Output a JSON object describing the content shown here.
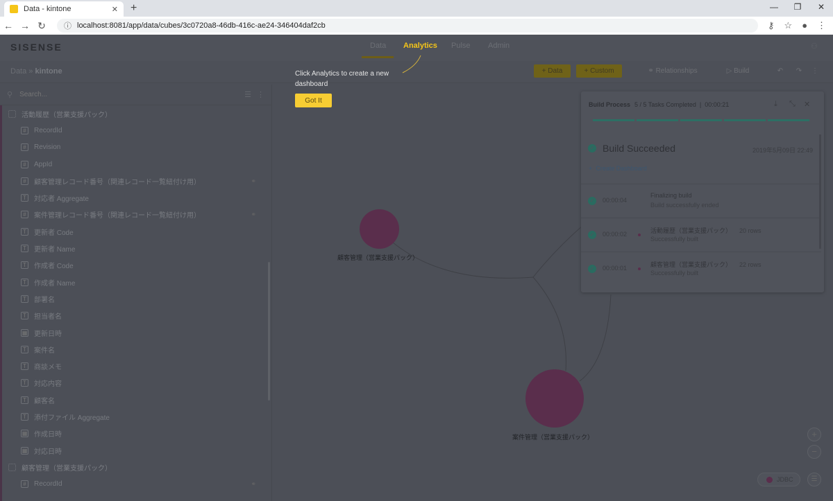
{
  "browser": {
    "tab_title": "Data - kintone",
    "url": "localhost:8081/app/data/cubes/3c0720a8-46db-416c-ae24-346404daf2cb"
  },
  "app": {
    "logo": "SISENSE",
    "nav": [
      "Data",
      "Analytics",
      "Pulse",
      "Admin"
    ]
  },
  "breadcrumb": {
    "root": "Data",
    "current": "kintone"
  },
  "toolbar": {
    "data": "+ Data",
    "custom": "+ Custom",
    "relationships": "Relationships",
    "build": "Build"
  },
  "sidebar": {
    "search_placeholder": "Search...",
    "tables": [
      {
        "name": "活動履歴（営業支援パック）",
        "fields": [
          {
            "name": "RecordId",
            "type": "#"
          },
          {
            "name": "Revision",
            "type": "#"
          },
          {
            "name": "AppId",
            "type": "#"
          },
          {
            "name": "顧客管理レコード番号（関連レコード一覧紐付け用）",
            "type": "#",
            "rel": true
          },
          {
            "name": "対応者 Aggregate",
            "type": "T"
          },
          {
            "name": "案件管理レコード番号（関連レコード一覧紐付け用）",
            "type": "#",
            "rel": true
          },
          {
            "name": "更新者 Code",
            "type": "T"
          },
          {
            "name": "更新者 Name",
            "type": "T"
          },
          {
            "name": "作成者 Code",
            "type": "T"
          },
          {
            "name": "作成者 Name",
            "type": "T"
          },
          {
            "name": "部署名",
            "type": "T"
          },
          {
            "name": "担当者名",
            "type": "T"
          },
          {
            "name": "更新日時",
            "type": "D"
          },
          {
            "name": "案件名",
            "type": "T"
          },
          {
            "name": "商談メモ",
            "type": "T"
          },
          {
            "name": "対応内容",
            "type": "T"
          },
          {
            "name": "顧客名",
            "type": "T"
          },
          {
            "name": "添付ファイル Aggregate",
            "type": "T"
          },
          {
            "name": "作成日時",
            "type": "D"
          },
          {
            "name": "対応日時",
            "type": "D"
          }
        ]
      },
      {
        "name": "顧客管理（営業支援パック）",
        "fields": [
          {
            "name": "RecordId",
            "type": "#",
            "rel": true
          }
        ]
      }
    ]
  },
  "tooltip": {
    "text": "Click Analytics to create a new dashboard",
    "button": "Got It"
  },
  "canvas": {
    "nodes": [
      "顧客管理（営業支援パック）",
      "案件管理（営業支援パック）"
    ],
    "connection": "JDBC"
  },
  "build": {
    "title": "Build Process",
    "tasks": "5 / 5 Tasks Completed",
    "elapsed": "00:00:21",
    "progress": 1.0,
    "status": "Build Succeeded",
    "date": "2019年5月09日 22:49",
    "create_dashboard": "Create Dashboard",
    "steps": [
      {
        "time": "00:00:04",
        "name": "Finalizing build",
        "status": "Build successfully ended",
        "rows": ""
      },
      {
        "time": "00:00:02",
        "name": "活動履歴（営業支援パック）",
        "status": "Successfully built",
        "rows": "20 rows"
      },
      {
        "time": "00:00:01",
        "name": "顧客管理（営業支援パック）",
        "status": "Successfully built",
        "rows": "22 rows"
      }
    ]
  }
}
